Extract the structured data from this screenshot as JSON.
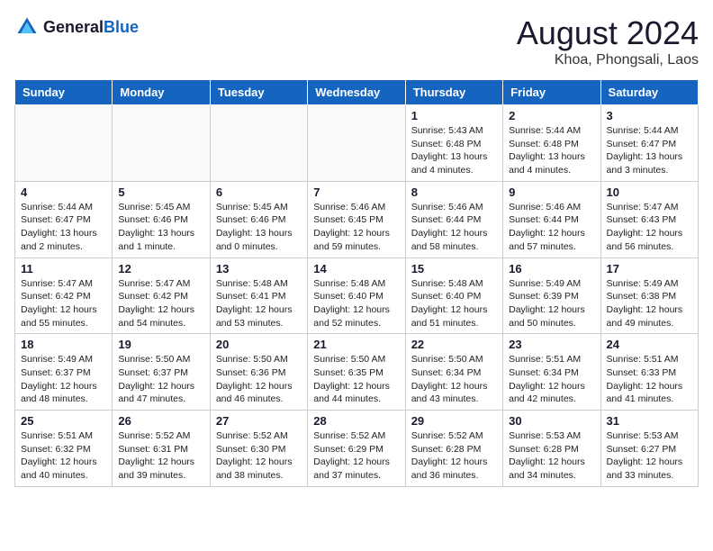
{
  "logo": {
    "text_general": "General",
    "text_blue": "Blue"
  },
  "title": "August 2024",
  "subtitle": "Khoa, Phongsali, Laos",
  "days_header": [
    "Sunday",
    "Monday",
    "Tuesday",
    "Wednesday",
    "Thursday",
    "Friday",
    "Saturday"
  ],
  "weeks": [
    [
      {
        "day": "",
        "info": ""
      },
      {
        "day": "",
        "info": ""
      },
      {
        "day": "",
        "info": ""
      },
      {
        "day": "",
        "info": ""
      },
      {
        "day": "1",
        "info": "Sunrise: 5:43 AM\nSunset: 6:48 PM\nDaylight: 13 hours\nand 4 minutes."
      },
      {
        "day": "2",
        "info": "Sunrise: 5:44 AM\nSunset: 6:48 PM\nDaylight: 13 hours\nand 4 minutes."
      },
      {
        "day": "3",
        "info": "Sunrise: 5:44 AM\nSunset: 6:47 PM\nDaylight: 13 hours\nand 3 minutes."
      }
    ],
    [
      {
        "day": "4",
        "info": "Sunrise: 5:44 AM\nSunset: 6:47 PM\nDaylight: 13 hours\nand 2 minutes."
      },
      {
        "day": "5",
        "info": "Sunrise: 5:45 AM\nSunset: 6:46 PM\nDaylight: 13 hours\nand 1 minute."
      },
      {
        "day": "6",
        "info": "Sunrise: 5:45 AM\nSunset: 6:46 PM\nDaylight: 13 hours\nand 0 minutes."
      },
      {
        "day": "7",
        "info": "Sunrise: 5:46 AM\nSunset: 6:45 PM\nDaylight: 12 hours\nand 59 minutes."
      },
      {
        "day": "8",
        "info": "Sunrise: 5:46 AM\nSunset: 6:44 PM\nDaylight: 12 hours\nand 58 minutes."
      },
      {
        "day": "9",
        "info": "Sunrise: 5:46 AM\nSunset: 6:44 PM\nDaylight: 12 hours\nand 57 minutes."
      },
      {
        "day": "10",
        "info": "Sunrise: 5:47 AM\nSunset: 6:43 PM\nDaylight: 12 hours\nand 56 minutes."
      }
    ],
    [
      {
        "day": "11",
        "info": "Sunrise: 5:47 AM\nSunset: 6:42 PM\nDaylight: 12 hours\nand 55 minutes."
      },
      {
        "day": "12",
        "info": "Sunrise: 5:47 AM\nSunset: 6:42 PM\nDaylight: 12 hours\nand 54 minutes."
      },
      {
        "day": "13",
        "info": "Sunrise: 5:48 AM\nSunset: 6:41 PM\nDaylight: 12 hours\nand 53 minutes."
      },
      {
        "day": "14",
        "info": "Sunrise: 5:48 AM\nSunset: 6:40 PM\nDaylight: 12 hours\nand 52 minutes."
      },
      {
        "day": "15",
        "info": "Sunrise: 5:48 AM\nSunset: 6:40 PM\nDaylight: 12 hours\nand 51 minutes."
      },
      {
        "day": "16",
        "info": "Sunrise: 5:49 AM\nSunset: 6:39 PM\nDaylight: 12 hours\nand 50 minutes."
      },
      {
        "day": "17",
        "info": "Sunrise: 5:49 AM\nSunset: 6:38 PM\nDaylight: 12 hours\nand 49 minutes."
      }
    ],
    [
      {
        "day": "18",
        "info": "Sunrise: 5:49 AM\nSunset: 6:37 PM\nDaylight: 12 hours\nand 48 minutes."
      },
      {
        "day": "19",
        "info": "Sunrise: 5:50 AM\nSunset: 6:37 PM\nDaylight: 12 hours\nand 47 minutes."
      },
      {
        "day": "20",
        "info": "Sunrise: 5:50 AM\nSunset: 6:36 PM\nDaylight: 12 hours\nand 46 minutes."
      },
      {
        "day": "21",
        "info": "Sunrise: 5:50 AM\nSunset: 6:35 PM\nDaylight: 12 hours\nand 44 minutes."
      },
      {
        "day": "22",
        "info": "Sunrise: 5:50 AM\nSunset: 6:34 PM\nDaylight: 12 hours\nand 43 minutes."
      },
      {
        "day": "23",
        "info": "Sunrise: 5:51 AM\nSunset: 6:34 PM\nDaylight: 12 hours\nand 42 minutes."
      },
      {
        "day": "24",
        "info": "Sunrise: 5:51 AM\nSunset: 6:33 PM\nDaylight: 12 hours\nand 41 minutes."
      }
    ],
    [
      {
        "day": "25",
        "info": "Sunrise: 5:51 AM\nSunset: 6:32 PM\nDaylight: 12 hours\nand 40 minutes."
      },
      {
        "day": "26",
        "info": "Sunrise: 5:52 AM\nSunset: 6:31 PM\nDaylight: 12 hours\nand 39 minutes."
      },
      {
        "day": "27",
        "info": "Sunrise: 5:52 AM\nSunset: 6:30 PM\nDaylight: 12 hours\nand 38 minutes."
      },
      {
        "day": "28",
        "info": "Sunrise: 5:52 AM\nSunset: 6:29 PM\nDaylight: 12 hours\nand 37 minutes."
      },
      {
        "day": "29",
        "info": "Sunrise: 5:52 AM\nSunset: 6:28 PM\nDaylight: 12 hours\nand 36 minutes."
      },
      {
        "day": "30",
        "info": "Sunrise: 5:53 AM\nSunset: 6:28 PM\nDaylight: 12 hours\nand 34 minutes."
      },
      {
        "day": "31",
        "info": "Sunrise: 5:53 AM\nSunset: 6:27 PM\nDaylight: 12 hours\nand 33 minutes."
      }
    ]
  ]
}
